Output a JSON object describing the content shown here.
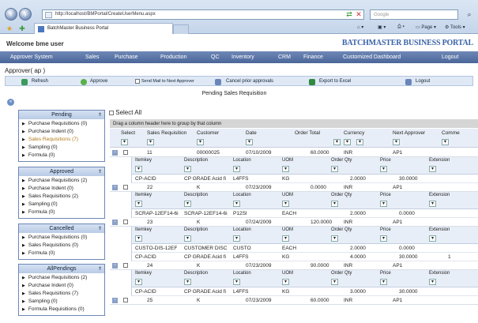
{
  "browser": {
    "address": "http://localhost/BMPortal/CreateUserMenu.aspx",
    "search_placeholder": "Google",
    "tab_title": "BatchMaster Business Portal",
    "page_label": "Page",
    "tools_label": "Tools"
  },
  "header": {
    "welcome": "Welcome bme user",
    "brand": "BATCHMASTER BUSINESS PORTAL"
  },
  "menu": [
    "Approver System",
    "Sales",
    "Purchase",
    "Production",
    "QC",
    "Inventory",
    "CRM",
    "Finance",
    "Customized Dashboard",
    "Logout"
  ],
  "approver_label": "Approver( ap )",
  "toolbar": {
    "refresh": "Refresh",
    "approve": "Approve",
    "send_mail": "Send Mail to Next Approver",
    "cancel_prior": "Cancel prior approvals",
    "export": "Export to Excel",
    "logout": "Logout"
  },
  "page_title": "Pending Sales Requisition",
  "panels": [
    {
      "title": "Pending",
      "items": [
        "Purchase Requisitions (0)",
        "Purchase Indent (0)",
        "Sales Requisitions (7)",
        "Sampling (0)",
        "Formula (0)"
      ]
    },
    {
      "title": "Approved",
      "items": [
        "Purchase Requisitions (2)",
        "Purchase Indent (0)",
        "Sales Requisitions (2)",
        "Sampling (0)",
        "Formula (0)"
      ]
    },
    {
      "title": "Cancelled",
      "items": [
        "Purchase Requisitions (0)",
        "Sales Requisitions (0)",
        "Formula (0)"
      ]
    },
    {
      "title": "AllPendings",
      "items": [
        "Purchase Requisitions (2)",
        "Purchase Indent (0)",
        "Sales Requisitions (7)",
        "Sampling (0)",
        "Formula Requisitions (0)"
      ]
    }
  ],
  "grid": {
    "select_all": "Select All",
    "drag_hint": "Drag a column header here to group by that column",
    "columns": [
      "Select",
      "Sales Requisition",
      "Customer",
      "Date",
      "Order Total",
      "Currency",
      "Next Approver",
      "Comme"
    ],
    "sub_columns": [
      "Itemkey",
      "Description",
      "Location",
      "UOM",
      "Order Qty",
      "Price",
      "Extension"
    ],
    "rows": [
      {
        "req": "11",
        "customer": "00000025",
        "date": "07/10/2009",
        "total": "60.0000",
        "currency": "INR",
        "next": "AP1"
      },
      {
        "req": "22",
        "customer": "K",
        "date": "07/23/2009",
        "total": "0.0000",
        "currency": "INR",
        "next": "AP1"
      },
      {
        "req": "23",
        "customer": "K",
        "date": "07/24/2009",
        "total": "120.0000",
        "currency": "INR",
        "next": "AP1"
      },
      {
        "req": "24",
        "customer": "K",
        "date": "07/23/2009",
        "total": "90.0000",
        "currency": "INR",
        "next": "AP1"
      },
      {
        "req": "25",
        "customer": "K",
        "date": "07/23/2009",
        "total": "60.0000",
        "currency": "INR",
        "next": "AP1"
      }
    ],
    "sub_rows": [
      [
        {
          "item": "CP-ACID",
          "desc": "CP GRADE Acid fi",
          "loc": "L4FFS",
          "uom": "KG",
          "qty": "2.0000",
          "price": "30.0000",
          "ext": ""
        }
      ],
      [
        {
          "item": "SCRAP-12EF14-6i",
          "desc": "SCRAP-12EF14-6i",
          "loc": "P12SI",
          "uom": "EACH",
          "qty": "2.0000",
          "price": "0.0000",
          "ext": ""
        }
      ],
      [
        {
          "item": "CUSTO-DIS-12EF",
          "desc": "CUSTOMER DISC",
          "loc": "CUSTO",
          "uom": "EACH",
          "qty": "2.0000",
          "price": "0.0000",
          "ext": ""
        },
        {
          "item": "CP-ACID",
          "desc": "CP GRADE Acid fi",
          "loc": "L4FFS",
          "uom": "KG",
          "qty": "4.0000",
          "price": "30.0000",
          "ext": "1"
        }
      ],
      [
        {
          "item": "CP-ACID",
          "desc": "CP GRADE Acid fi",
          "loc": "L4FFS",
          "uom": "KG",
          "qty": "3.0000",
          "price": "30.0000",
          "ext": ""
        }
      ]
    ]
  }
}
